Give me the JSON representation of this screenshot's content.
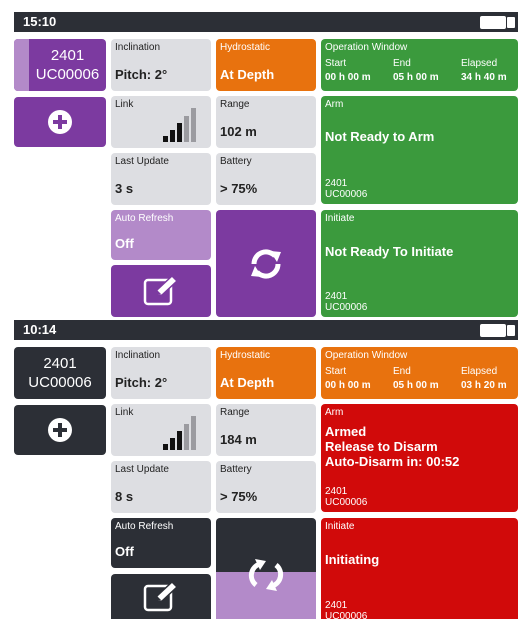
{
  "screens": [
    {
      "status_time": "15:10",
      "device": {
        "line1": "2401",
        "line2": "UC00006"
      },
      "inclination": {
        "label": "Inclination",
        "value": "Pitch: 2°"
      },
      "hydrostatic": {
        "label": "Hydrostatic",
        "value": "At Depth"
      },
      "operation_window": {
        "title": "Operation Window",
        "headers": [
          "Start",
          "End",
          "Elapsed"
        ],
        "values": [
          "00 h 00 m",
          "05 h 00 m",
          "34 h 40 m"
        ]
      },
      "link": {
        "label": "Link",
        "signal_bars_active": 3,
        "signal_bars_total": 5
      },
      "range": {
        "label": "Range",
        "value": "102 m"
      },
      "arm": {
        "label": "Arm",
        "lines": [
          "Not Ready to Arm"
        ],
        "id1": "2401",
        "id2": "UC00006",
        "color": "#3b9a3d"
      },
      "last_update": {
        "label": "Last Update",
        "value": "3 s"
      },
      "battery": {
        "label": "Battery",
        "value": "> 75%"
      },
      "auto_refresh": {
        "label": "Auto Refresh",
        "value": "Off"
      },
      "initiate": {
        "label": "Initiate",
        "lines": [
          "Not Ready To Initiate"
        ],
        "id1": "2401",
        "id2": "UC00006",
        "color": "#3b9a3d"
      }
    },
    {
      "status_time": "10:14",
      "device": {
        "line1": "2401",
        "line2": "UC00006"
      },
      "inclination": {
        "label": "Inclination",
        "value": "Pitch: 2°"
      },
      "hydrostatic": {
        "label": "Hydrostatic",
        "value": "At Depth"
      },
      "operation_window": {
        "title": "Operation Window",
        "headers": [
          "Start",
          "End",
          "Elapsed"
        ],
        "values": [
          "00 h 00 m",
          "05 h 00 m",
          "03 h 20 m"
        ]
      },
      "link": {
        "label": "Link",
        "signal_bars_active": 3,
        "signal_bars_total": 5
      },
      "range": {
        "label": "Range",
        "value": "184 m"
      },
      "arm": {
        "label": "Arm",
        "lines": [
          "Armed",
          "Release to Disarm",
          "Auto-Disarm in: 00:52"
        ],
        "id1": "2401",
        "id2": "UC00006",
        "color": "#d10a0a"
      },
      "last_update": {
        "label": "Last Update",
        "value": "8 s"
      },
      "battery": {
        "label": "Battery",
        "value": "> 75%"
      },
      "auto_refresh": {
        "label": "Auto Refresh",
        "value": "Off"
      },
      "initiate": {
        "label": "Initiate",
        "lines": [
          "Initiating"
        ],
        "id1": "2401",
        "id2": "UC00006",
        "color": "#d10a0a"
      }
    }
  ],
  "icons": {
    "add": "plus-circle-icon",
    "edit": "edit-pencil-icon",
    "refresh": "refresh-arrows-icon",
    "signal": "signal-bars-icon",
    "battery": "battery-status-icon"
  }
}
